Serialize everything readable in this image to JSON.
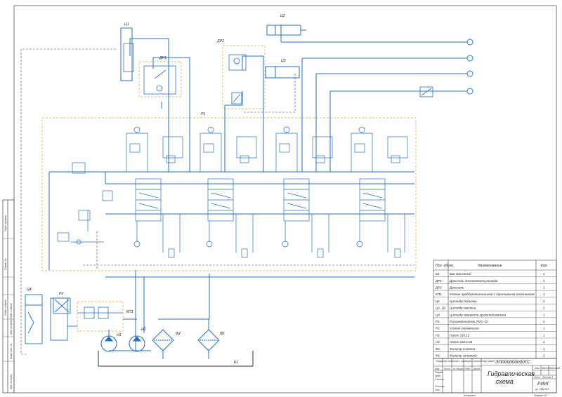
{
  "labels": {
    "b1": "Б1",
    "dp1": "ДР1",
    "dp2": "ДР2",
    "kp1": "КП1",
    "ts1": "Ц1",
    "ts2": "Ц2",
    "ts3": "Ц3",
    "ts4": "Ц4",
    "r1": "Р1",
    "r2": "Р2",
    "n1": "Н1",
    "n2": "Н2",
    "f1": "Ф1",
    "f2": "Ф2"
  },
  "spec_table": {
    "headers": [
      "Поз. обозн.",
      "Наименование",
      "Кол."
    ],
    "rows": [
      {
        "pos": "Б1",
        "name": "Бак масляный",
        "qty": "1"
      },
      {
        "pos": "ДР1",
        "name": "Дроссель постоянного расхода",
        "qty": "1"
      },
      {
        "pos": "ДР2",
        "name": "Дроссель",
        "qty": "1"
      },
      {
        "pos": "КП1",
        "name": "Клапан предохранительный с переливным золотником",
        "qty": "1"
      },
      {
        "pos": "Ц1",
        "name": "Цилиндр подъема",
        "qty": "1"
      },
      {
        "pos": "Ц2, Ц3",
        "name": "Цилиндр наклона",
        "qty": "2"
      },
      {
        "pos": "Ц4",
        "name": "Цилиндр поворота грузоподъемника",
        "qty": "1"
      },
      {
        "pos": "Р1",
        "name": "Распределитель PVG 32",
        "qty": "1"
      },
      {
        "pos": "Р2",
        "name": "Клапан управления",
        "qty": "1"
      },
      {
        "pos": "Н1",
        "name": "Насос 310.12",
        "qty": "1"
      },
      {
        "pos": "Н2",
        "name": "Насос 310.2.28",
        "qty": "1"
      },
      {
        "pos": "Ф1",
        "name": "Фильтр сливной",
        "qty": "1"
      },
      {
        "pos": "Ф2",
        "name": "Фильтр заливной",
        "qty": "1"
      }
    ]
  },
  "title_block": {
    "code": "ЭП000000000ГС",
    "title_line1": "Гидравлическая",
    "title_line2": "схема",
    "note": "Погрузчик вилочный с шарнирно-сочлененной рамой",
    "lit_header": "Лит.",
    "mass_header": "Масса",
    "scale_header": "Масштаб",
    "sheet": "Лист",
    "sheets": "Листов 1",
    "org_line1": "РИИГ",
    "org_line2": "гр. ТДМ-511",
    "copied": "Копировал",
    "format": "Формат А3",
    "rows": [
      "Изм.",
      "Лист",
      "№ докум.",
      "Подп.",
      "Дата"
    ],
    "roles": [
      "Разраб.",
      "Пров.",
      "Т.контр.",
      "Н.контр.",
      "Утв."
    ]
  },
  "side_strip": [
    "Перв. примен.",
    "Справ. №",
    "Подп. и дата",
    "Инв. № дубл.",
    "Взам. инв. №",
    "Подп. и дата",
    "Инв. № подл."
  ]
}
